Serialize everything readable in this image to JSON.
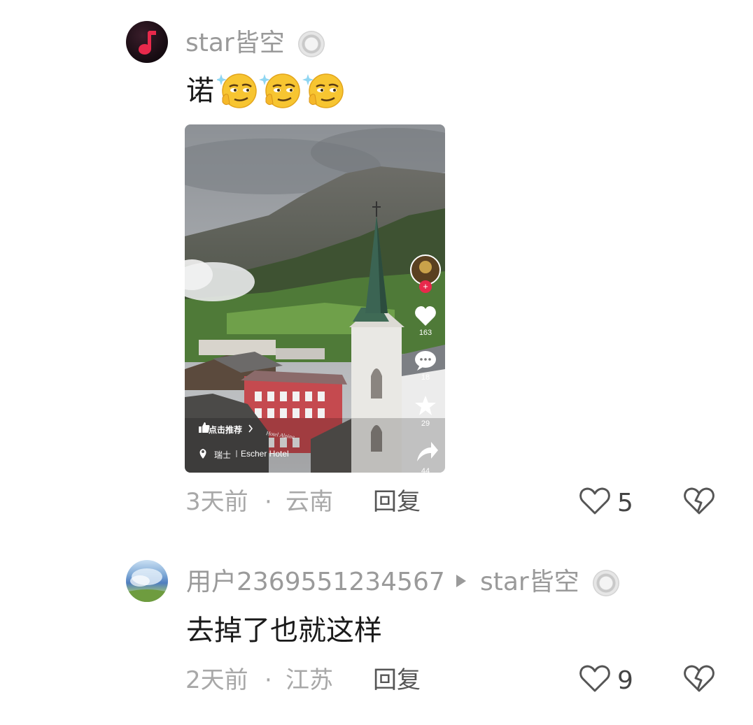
{
  "comments": [
    {
      "username": "star皆空",
      "text": "诺",
      "emoji_count": 3,
      "emoji_name": "thinking-smirk-emoji",
      "time": "3天前",
      "location": "云南",
      "separator": "·",
      "reply_label": "回复",
      "likes": "5"
    },
    {
      "username": "用户2369551234567",
      "reply_to": "star皆空",
      "text": "去掉了也就这样",
      "time": "2天前",
      "location": "江苏",
      "separator": "·",
      "reply_label": "回复",
      "likes": "9"
    }
  ],
  "video": {
    "likes": "163",
    "comments": "18",
    "favorites": "29",
    "shares": "44",
    "recommend_label": "点击推荐",
    "location_country": "瑞士",
    "location_place": "Escher Hotel",
    "sign_text": "Hotel Alpina"
  },
  "icons": {
    "avatar1": "music-note-icon",
    "verified": "verified-badge-icon",
    "like": "heart-outline-icon",
    "dislike": "broken-heart-icon",
    "reply_arrow": "triangle-right-icon"
  },
  "colors": {
    "brand_red": "#e8294b",
    "meta_gray": "#a8a8a8",
    "name_gray": "#9a9a9a"
  }
}
